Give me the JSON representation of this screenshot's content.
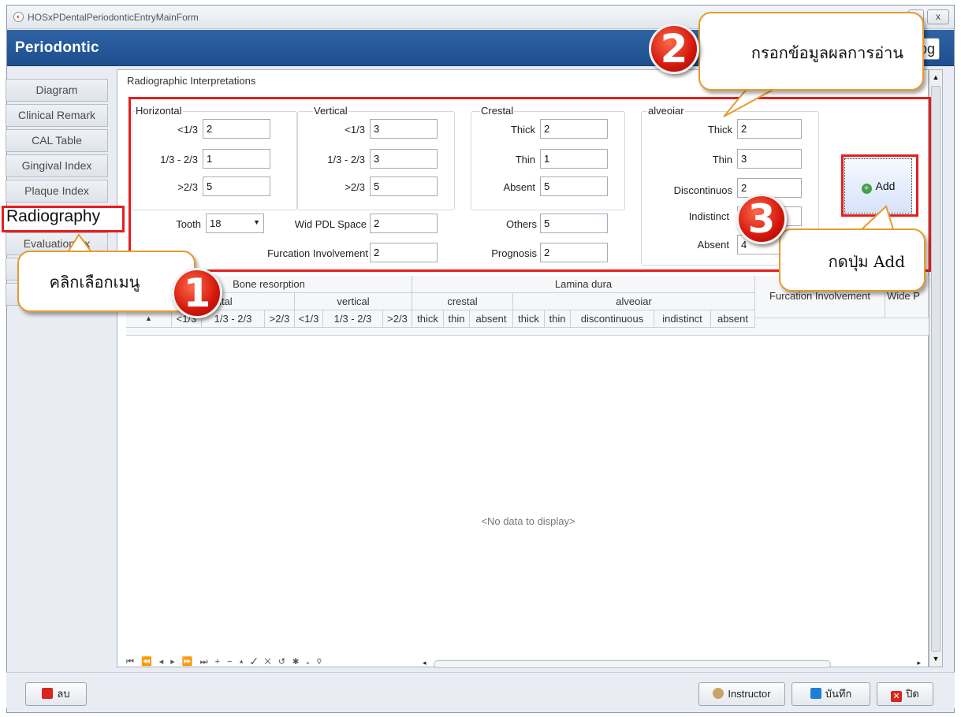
{
  "window": {
    "title": "HOSxPDentalPeriodonticEntryMainForm",
    "close_glyph": "x"
  },
  "header": {
    "title": "Periodontic",
    "right_button": "og"
  },
  "nav": {
    "items": [
      "Diagram",
      "Clinical Remark",
      "CAL Table",
      "Gingival Index",
      "Plaque Index",
      "Radiography",
      "Evaluation Tx"
    ]
  },
  "section": {
    "title": "Radiographic Interpretations"
  },
  "form": {
    "horizontal": {
      "label": "Horizontal",
      "lt13_label": "<1/3",
      "lt13": "2",
      "m13_label": "1/3 - 2/3",
      "m13": "1",
      "gt23_label": ">2/3",
      "gt23": "5"
    },
    "vertical": {
      "label": "Vertical",
      "lt13_label": "<1/3",
      "lt13": "3",
      "m13_label": "1/3 - 2/3",
      "m13": "3",
      "gt23_label": ">2/3",
      "gt23": "5"
    },
    "crestal": {
      "label": "Crestal",
      "thick_label": "Thick",
      "thick": "2",
      "thin_label": "Thin",
      "thin": "1",
      "absent_label": "Absent",
      "absent": "5"
    },
    "alveolar": {
      "label": "alveoiar",
      "thick_label": "Thick",
      "thick": "2",
      "thin_label": "Thin",
      "thin": "3",
      "discontinuous_label": "Discontinuos",
      "discontinuous": "2",
      "indistinct_label": "Indistinct",
      "indistinct": "",
      "absent_label": "Absent",
      "absent": "4"
    },
    "tooth_label": "Tooth",
    "tooth": "18",
    "wid_pdl_label": "Wid PDL Space",
    "wid_pdl": "2",
    "furcation_label": "Furcation Involvement",
    "furcation": "2",
    "others_label": "Others",
    "others": "5",
    "prognosis_label": "Prognosis",
    "prognosis": "2",
    "add_label": "Add"
  },
  "grid": {
    "bone_resorption": "Bone resorption",
    "lamina_dura": "Lamina dura",
    "horizontal": "horizontal",
    "vertical": "vertical",
    "crestal": "crestal",
    "alveolar": "alveoiar",
    "furcation": "Furcation Involvement",
    "wide": "Wide P",
    "cols": [
      "<1/3",
      "1/3 - 2/3",
      ">2/3",
      "<1/3",
      "1/3 - 2/3",
      ">2/3",
      "thick",
      "thin",
      "absent",
      "thick",
      "thin",
      "discontinuous",
      "indistinct",
      "absent"
    ],
    "empty": "<No data to display>",
    "navigator": "⏮ ⏪ ◂ ▸ ⏩ ⏭ + − ▴ ✓ ✕ ↺ ✱ ⁎ ⊽"
  },
  "footer": {
    "delete": "ลบ",
    "instructor": "Instructor",
    "save": "บันทึก",
    "close": "ปิด"
  },
  "callouts": {
    "one": "คลิกเลือกเมนู",
    "two": "กรอกข้อมูลผลการอ่าน",
    "three": "กดปุ่ม Add"
  },
  "badges": {
    "one": "1",
    "two": "2",
    "three": "3"
  },
  "colors": {
    "header": "#2a5a9b",
    "highlight": "#e41e1e",
    "callout_border": "#e79b2d",
    "badge": "#d3160c"
  }
}
